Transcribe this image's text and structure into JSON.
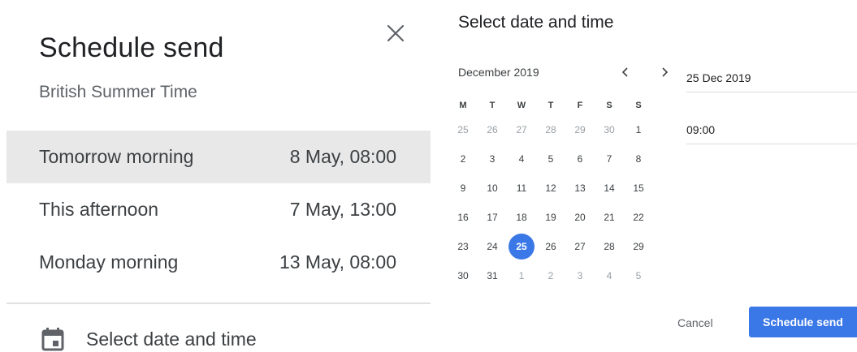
{
  "left_panel": {
    "title": "Schedule send",
    "subtitle": "British Summer Time",
    "options": [
      {
        "label": "Tomorrow morning",
        "time": "8 May, 08:00"
      },
      {
        "label": "This afternoon",
        "time": "7 May, 13:00"
      },
      {
        "label": "Monday morning",
        "time": "13 May, 08:00"
      }
    ],
    "select_date_label": "Select date and time"
  },
  "right_panel": {
    "title": "Select date and time",
    "calendar": {
      "month_label": "December 2019",
      "weekdays": [
        "M",
        "T",
        "W",
        "T",
        "F",
        "S",
        "S"
      ],
      "weeks": [
        [
          {
            "d": "25",
            "m": true
          },
          {
            "d": "26",
            "m": true
          },
          {
            "d": "27",
            "m": true
          },
          {
            "d": "28",
            "m": true
          },
          {
            "d": "29",
            "m": true
          },
          {
            "d": "30",
            "m": true
          },
          {
            "d": "1"
          }
        ],
        [
          {
            "d": "2"
          },
          {
            "d": "3"
          },
          {
            "d": "4"
          },
          {
            "d": "5"
          },
          {
            "d": "6"
          },
          {
            "d": "7"
          },
          {
            "d": "8"
          }
        ],
        [
          {
            "d": "9"
          },
          {
            "d": "10"
          },
          {
            "d": "11"
          },
          {
            "d": "12"
          },
          {
            "d": "13"
          },
          {
            "d": "14"
          },
          {
            "d": "15"
          }
        ],
        [
          {
            "d": "16"
          },
          {
            "d": "17"
          },
          {
            "d": "18"
          },
          {
            "d": "19"
          },
          {
            "d": "20"
          },
          {
            "d": "21"
          },
          {
            "d": "22"
          }
        ],
        [
          {
            "d": "23"
          },
          {
            "d": "24"
          },
          {
            "d": "25",
            "sel": true
          },
          {
            "d": "26"
          },
          {
            "d": "27"
          },
          {
            "d": "28"
          },
          {
            "d": "29"
          }
        ],
        [
          {
            "d": "30"
          },
          {
            "d": "31"
          },
          {
            "d": "1",
            "m": true
          },
          {
            "d": "2",
            "m": true
          },
          {
            "d": "3",
            "m": true
          },
          {
            "d": "4",
            "m": true
          },
          {
            "d": "5",
            "m": true
          }
        ]
      ]
    },
    "date_value": "25 Dec 2019",
    "time_value": "09:00",
    "cancel_label": "Cancel",
    "send_label": "Schedule send"
  },
  "colors": {
    "accent": "#3b78e7",
    "active_row": "#e8e8e8",
    "muted_text": "#9aa0a6"
  },
  "icons": {
    "close": "close-icon",
    "calendar": "calendar-icon",
    "prev": "chevron-left-icon",
    "next": "chevron-right-icon"
  }
}
